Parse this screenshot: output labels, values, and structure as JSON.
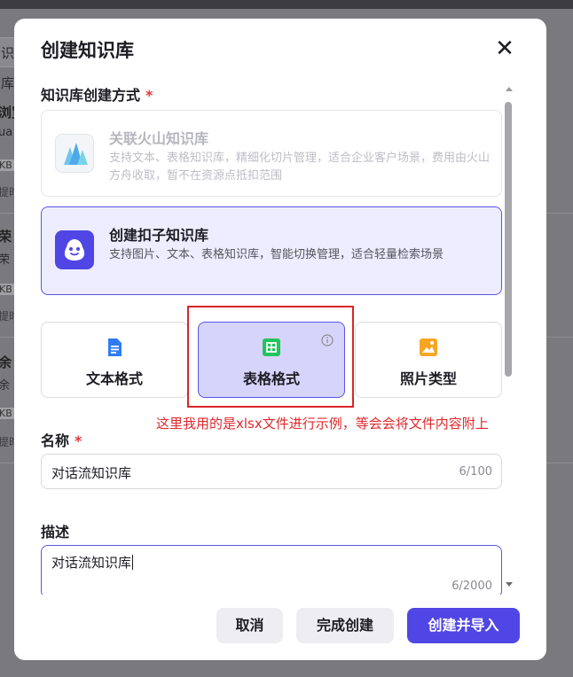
{
  "background": {
    "search_fragment": "识库",
    "rows": [
      {
        "t1": "浏览",
        "t2": "ua",
        "kb": "KB",
        "t3": "提时"
      },
      {
        "t1": "荣",
        "t2": "荣",
        "kb": "KB",
        "t3": "提时"
      },
      {
        "t1": "余",
        "t2": "余",
        "kb": "KB",
        "t3": "提时"
      }
    ]
  },
  "modal": {
    "title": "创建知识库",
    "close_icon": "close-icon",
    "method_label": "知识库创建方式",
    "required_mark": "*",
    "methods": [
      {
        "title": "关联火山知识库",
        "desc": "支持文本、表格知识库，精细化切片管理，适合企业客户场景，费用由火山方舟收取，暂不在资源点抵扣范围",
        "icon": "volcano-logo-icon",
        "state": "disabled"
      },
      {
        "title": "创建扣子知识库",
        "desc": "支持图片、文本、表格知识库，智能切换管理，适合轻量检索场景",
        "icon": "coze-logo-icon",
        "state": "selected"
      }
    ],
    "formats": [
      {
        "label": "文本格式",
        "icon": "document-icon",
        "active": false
      },
      {
        "label": "表格格式",
        "icon": "table-icon",
        "active": true
      },
      {
        "label": "照片类型",
        "icon": "image-icon",
        "active": false
      }
    ],
    "annotation": "这里我用的是xlsx文件进行示例，等会会将文件内容附上",
    "name_field": {
      "label": "名称",
      "value": "对话流知识库",
      "counter": "6/100"
    },
    "desc_field": {
      "label": "描述",
      "value": "对话流知识库",
      "counter": "6/2000"
    },
    "buttons": {
      "cancel": "取消",
      "create": "完成创建",
      "create_import": "创建并导入"
    },
    "colors": {
      "accent": "#5046e5",
      "annotation_red": "#e0282c",
      "selected_bg": "#eeedff"
    }
  }
}
